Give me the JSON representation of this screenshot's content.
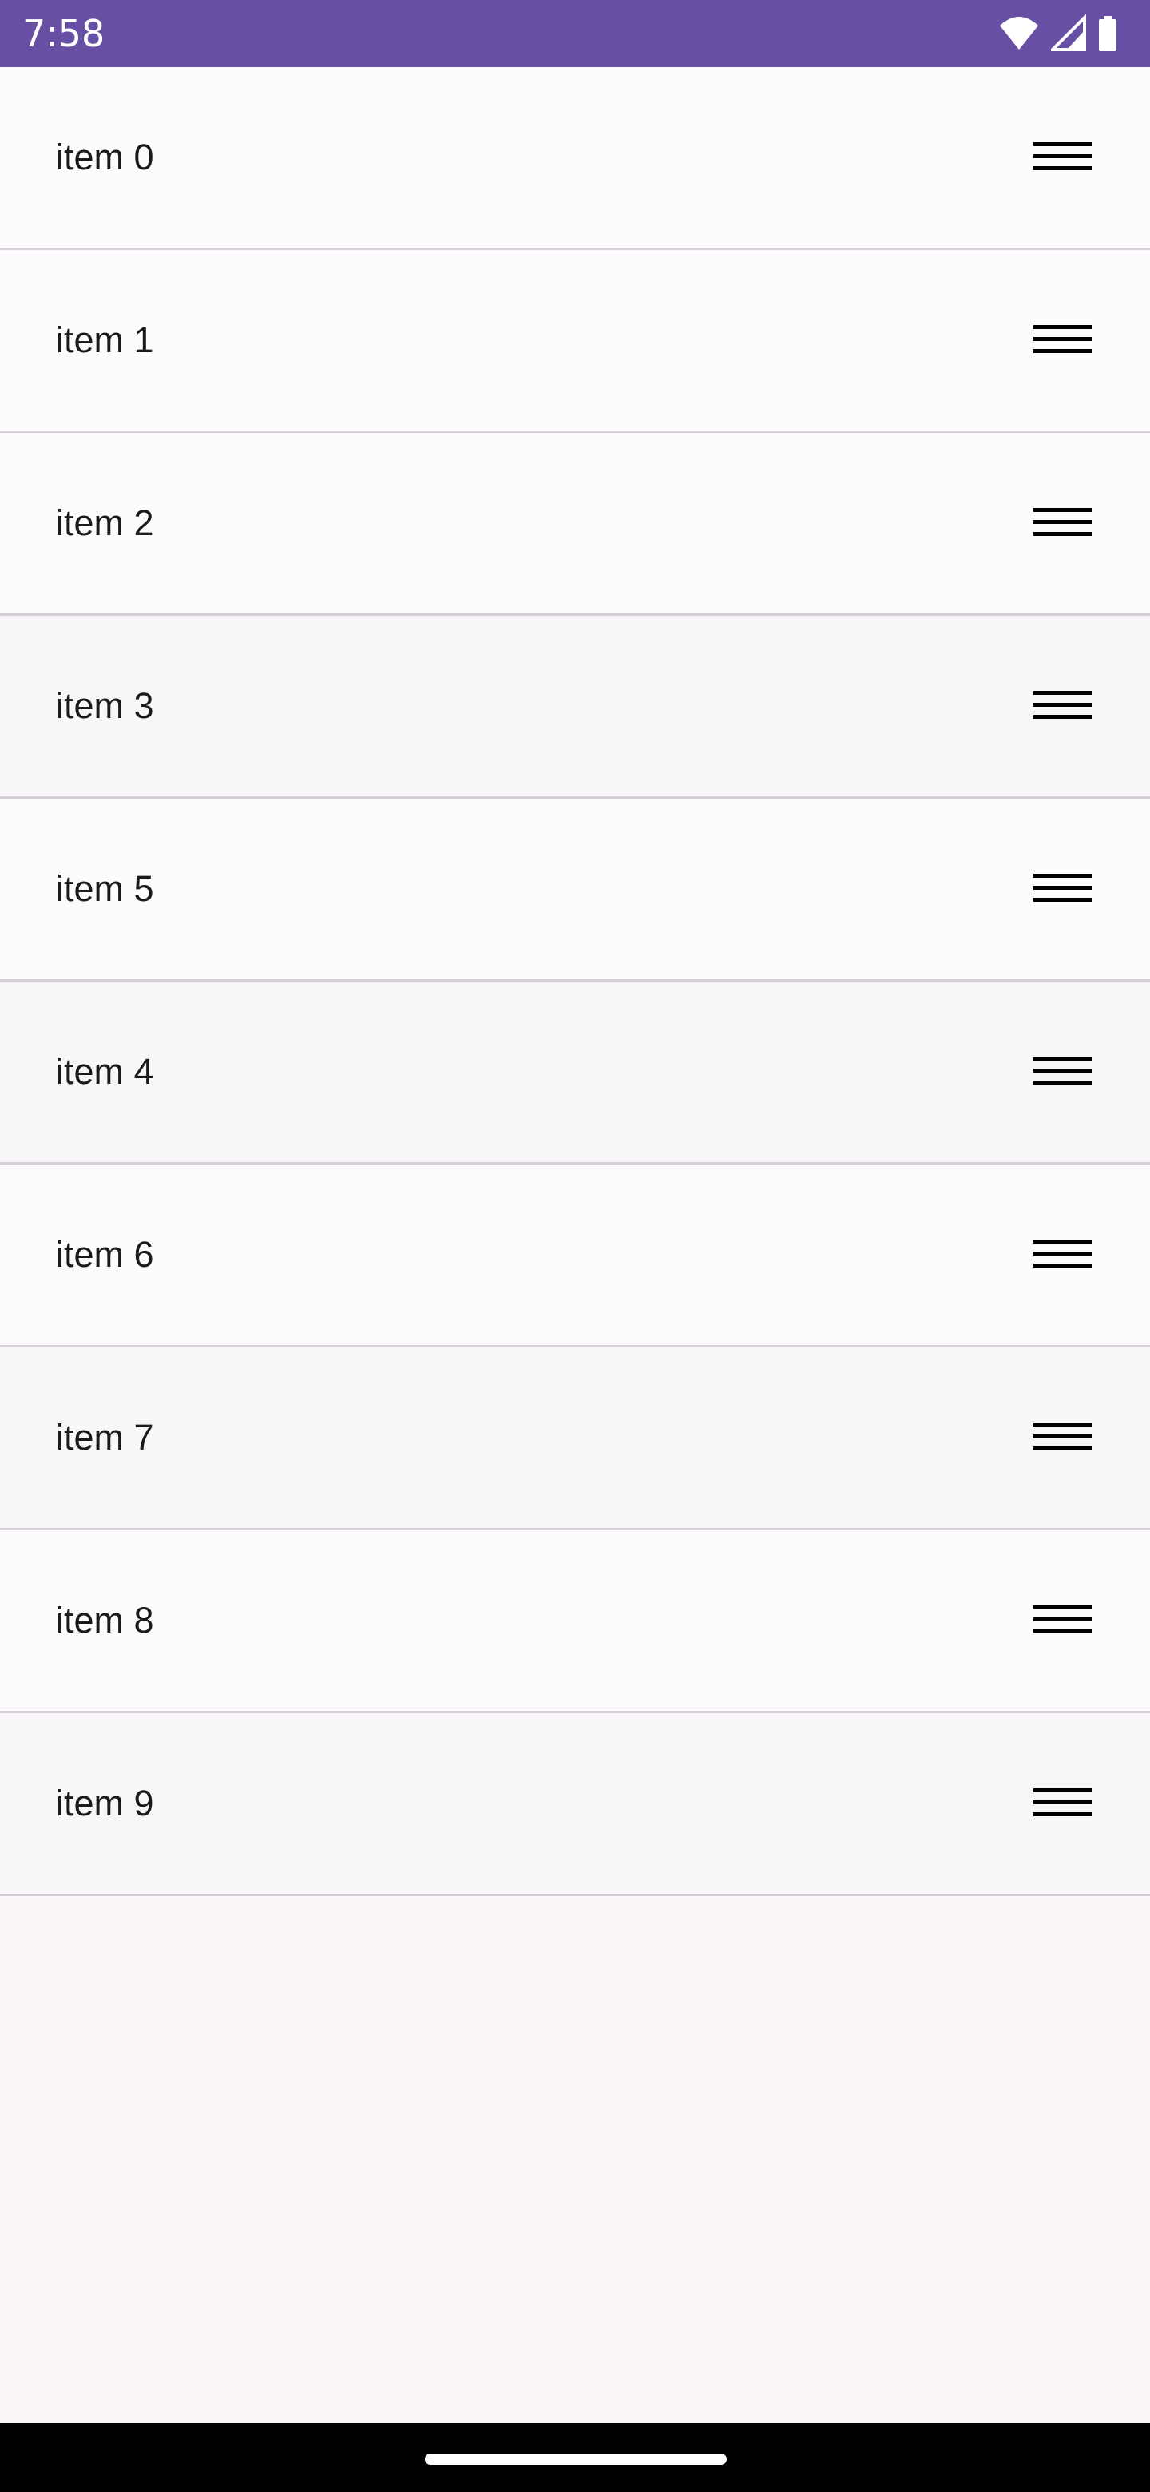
{
  "status_bar": {
    "time": "7:58",
    "background_color": "#6750a4",
    "icons": [
      "wifi-icon",
      "cellular-signal-icon",
      "battery-icon"
    ]
  },
  "list": {
    "items": [
      {
        "label": "item 0"
      },
      {
        "label": "item 1"
      },
      {
        "label": "item 2"
      },
      {
        "label": "item 3"
      },
      {
        "label": "item 5"
      },
      {
        "label": "item 4"
      },
      {
        "label": "item 6"
      },
      {
        "label": "item 7"
      },
      {
        "label": "item 8"
      },
      {
        "label": "item 9"
      }
    ],
    "row_action_icon": "drag-handle-icon"
  },
  "navigation_bar": {
    "icon": "home-gesture-bar"
  }
}
